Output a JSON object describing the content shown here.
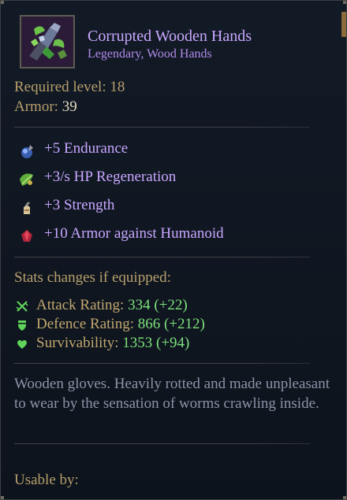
{
  "item": {
    "name": "Corrupted Wooden Hands",
    "subtitle": "Legendary, Wood Hands"
  },
  "requirements": {
    "level_label": "Required level:",
    "level_value": "18",
    "armor_label": "Armor:",
    "armor_value": "39"
  },
  "bonuses": [
    {
      "icon": "endurance-orb-icon",
      "text": "+5 Endurance"
    },
    {
      "icon": "regeneration-leaf-icon",
      "text": "+3/s HP Regeneration"
    },
    {
      "icon": "strength-fist-icon",
      "text": "+3 Strength"
    },
    {
      "icon": "armor-gem-icon",
      "text": "+10 Armor against Humanoid"
    }
  ],
  "comparison": {
    "heading": "Stats changes if equipped:",
    "stats": [
      {
        "icon": "crossed-swords-icon",
        "label": "Attack Rating:",
        "value": "334 (+22)"
      },
      {
        "icon": "shield-icon",
        "label": "Defence Rating:",
        "value": "866 (+212)"
      },
      {
        "icon": "heart-icon",
        "label": "Survivability:",
        "value": "1353 (+94)"
      }
    ]
  },
  "description": "Wooden gloves. Heavily rotted and made unpleasant to wear by the sensation of worms crawling inside.",
  "usable_by_label": "Usable by:",
  "colors": {
    "legendary": "#c9a7ff",
    "label_gold": "#b89f6c",
    "stat_green": "#7ee07c",
    "description": "#8c93a8"
  }
}
